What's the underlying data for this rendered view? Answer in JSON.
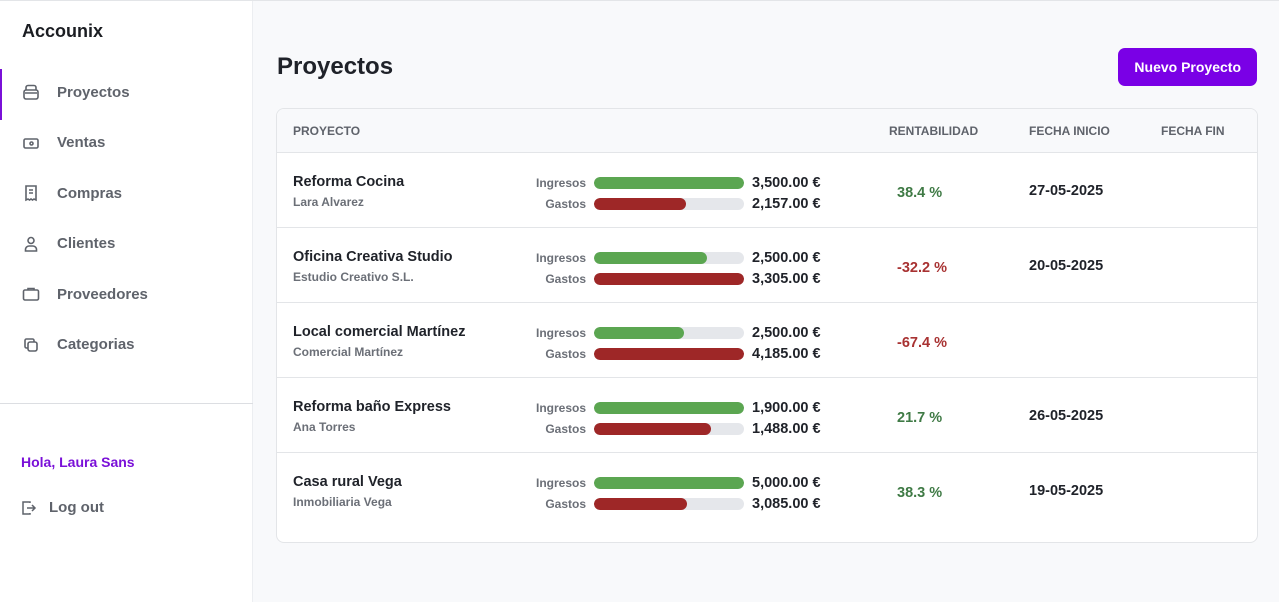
{
  "app": {
    "brand": "Accounix"
  },
  "sidebar": {
    "items": [
      {
        "label": "Proyectos",
        "icon": "archive-icon"
      },
      {
        "label": "Ventas",
        "icon": "cash-icon"
      },
      {
        "label": "Compras",
        "icon": "receipt-icon"
      },
      {
        "label": "Clientes",
        "icon": "user-icon"
      },
      {
        "label": "Proveedores",
        "icon": "briefcase-icon"
      },
      {
        "label": "Categorias",
        "icon": "copy-icon"
      }
    ],
    "greeting": "Hola, Laura Sans",
    "logout": "Log out"
  },
  "main": {
    "title": "Proyectos",
    "new_button": "Nuevo Proyecto",
    "headers": {
      "project": "PROYECTO",
      "profit": "RENTABILIDAD",
      "start": "FECHA INICIO",
      "end": "FECHA FIN"
    },
    "labels": {
      "income": "Ingresos",
      "expense": "Gastos"
    },
    "colors": {
      "income": "#5ba651",
      "expense": "#9e2727",
      "positive": "#3f7a45",
      "negative": "#a83232"
    },
    "rows": [
      {
        "name": "Reforma Cocina",
        "client": "Lara Alvarez",
        "income": "3,500.00 €",
        "expense": "2,157.00 €",
        "income_v": 3500,
        "expense_v": 2157,
        "profit": "38.4 %",
        "positive": true,
        "start": "27-05-2025",
        "end": ""
      },
      {
        "name": "Oficina Creativa Studio",
        "client": "Estudio Creativo S.L.",
        "income": "2,500.00 €",
        "expense": "3,305.00 €",
        "income_v": 2500,
        "expense_v": 3305,
        "profit": "-32.2 %",
        "positive": false,
        "start": "20-05-2025",
        "end": ""
      },
      {
        "name": "Local comercial Martínez",
        "client": "Comercial Martínez",
        "income": "2,500.00 €",
        "expense": "4,185.00 €",
        "income_v": 2500,
        "expense_v": 4185,
        "profit": "-67.4 %",
        "positive": false,
        "start": "",
        "end": ""
      },
      {
        "name": "Reforma baño Express",
        "client": "Ana Torres",
        "income": "1,900.00 €",
        "expense": "1,488.00 €",
        "income_v": 1900,
        "expense_v": 1488,
        "profit": "21.7 %",
        "positive": true,
        "start": "26-05-2025",
        "end": ""
      },
      {
        "name": "Casa rural Vega",
        "client": "Inmobiliaria Vega",
        "income": "5,000.00 €",
        "expense": "3,085.00 €",
        "income_v": 5000,
        "expense_v": 3085,
        "profit": "38.3 %",
        "positive": true,
        "start": "19-05-2025",
        "end": ""
      }
    ]
  }
}
